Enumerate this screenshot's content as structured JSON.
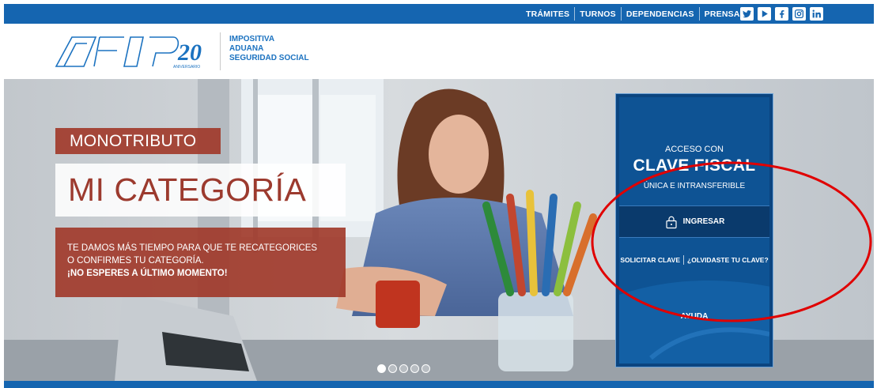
{
  "topnav": {
    "items": [
      "TRÁMITES",
      "TURNOS",
      "DEPENDENCIAS",
      "PRENSA"
    ],
    "social_icons": [
      "twitter-icon",
      "youtube-icon",
      "facebook-icon",
      "instagram-icon",
      "linkedin-icon"
    ]
  },
  "header": {
    "logo_text": "AFIP 20 ANIVERSARIO",
    "subs": [
      "IMPOSITIVA",
      "ADUANA",
      "SEGURIDAD SOCIAL"
    ]
  },
  "hero": {
    "label": "MONOTRIBUTO",
    "title": "MI CATEGORÍA",
    "text_line1": "TE DAMOS MÁS TIEMPO PARA QUE TE RECATEGORICES",
    "text_line2": "O CONFIRMES TU CATEGORÍA.",
    "text_strong": "¡NO ESPERES A ÚLTIMO MOMENTO!",
    "active_slide": 1,
    "slide_count": 5
  },
  "login": {
    "pre": "ACCESO CON",
    "title": "CLAVE FISCAL",
    "sub": "ÚNICA E INTRANSFERIBLE",
    "ingresar": "INGRESAR",
    "solicitar": "SOLICITAR CLAVE",
    "olvidaste": "¿OLVIDASTE TU CLAVE?",
    "ayuda": "AYUDA"
  },
  "colors": {
    "brand_blue": "#1565b0",
    "promo_red": "#a03728",
    "panel_blue": "#0e5394",
    "annotation_red": "#e00000"
  }
}
